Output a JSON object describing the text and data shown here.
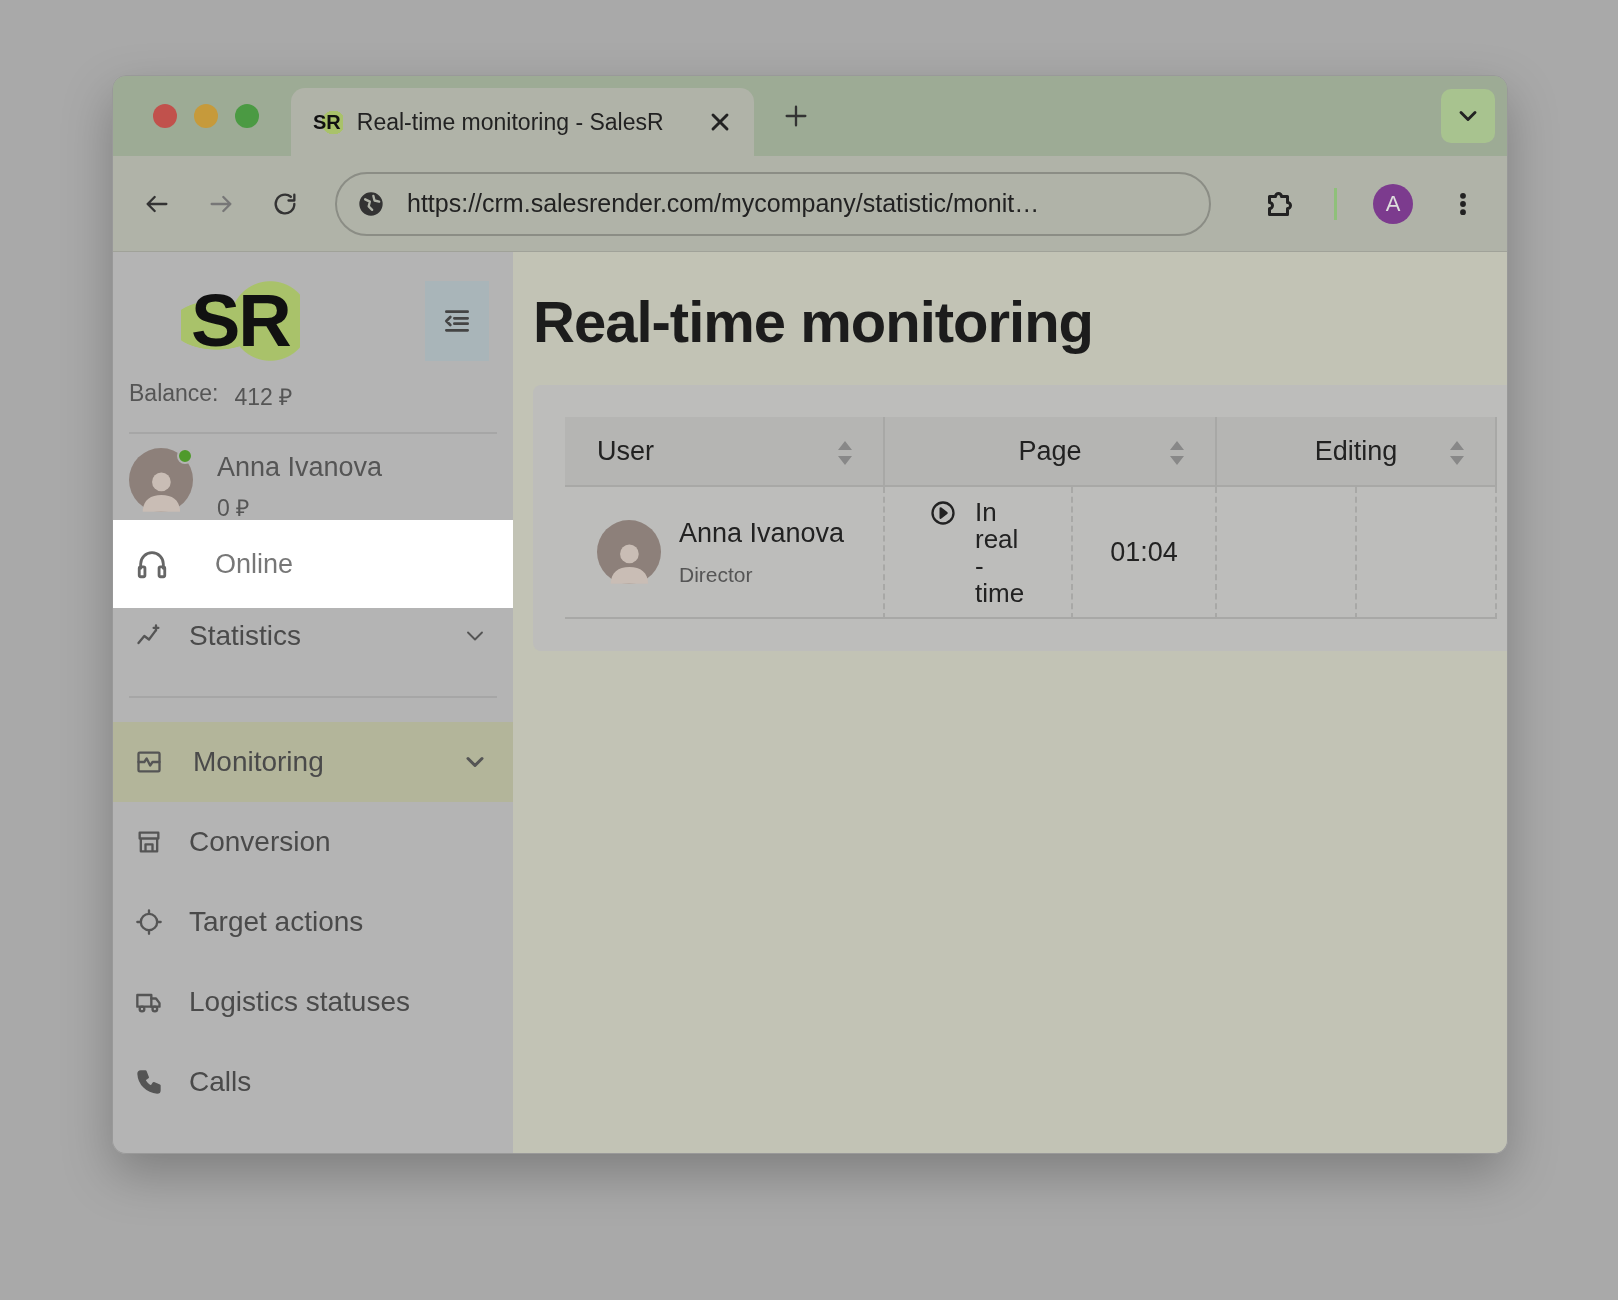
{
  "browser": {
    "tab": {
      "favicon": "SR",
      "title": "Real-time monitoring - SalesR"
    },
    "url": "https://crm.salesrender.com/mycompany/statistic/monit…",
    "profile_initial": "A"
  },
  "sidebar": {
    "logo": "SR",
    "balance_label": "Balance:",
    "balance_value": "412 ₽",
    "user": {
      "name": "Anna Ivanova",
      "amount": "0 ₽",
      "online": true
    },
    "status": {
      "label": "Online"
    },
    "sections": [
      [
        {
          "label": "Statistics",
          "kind": "group",
          "selected": false
        }
      ],
      [
        {
          "label": "Monitoring",
          "kind": "group",
          "selected": true
        },
        {
          "label": "Conversion",
          "kind": "item",
          "selected": false
        },
        {
          "label": "Target actions",
          "kind": "item",
          "selected": false
        },
        {
          "label": "Logistics statuses",
          "kind": "item",
          "selected": false
        },
        {
          "label": "Calls",
          "kind": "item",
          "selected": false
        }
      ]
    ]
  },
  "main": {
    "title": "Real-time monitoring",
    "table": {
      "columns": [
        {
          "label": "User"
        },
        {
          "label": "Page"
        },
        {
          "label": "Editing"
        }
      ],
      "rows": [
        {
          "name": "Anna Ivanova",
          "role": "Director",
          "page": "In real - time",
          "time": "01:04"
        }
      ]
    }
  }
}
